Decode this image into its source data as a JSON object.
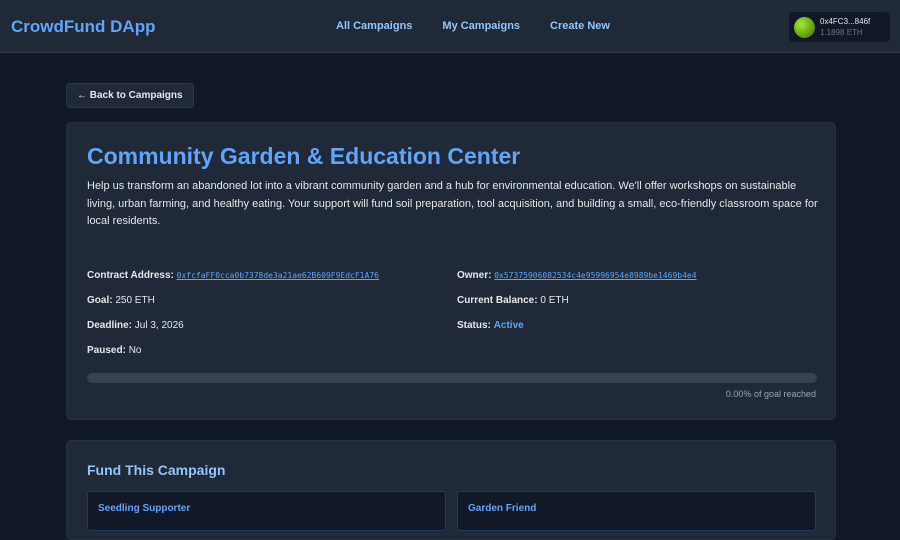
{
  "nav": {
    "brand": "CrowdFund DApp",
    "links": [
      "All Campaigns",
      "My Campaigns",
      "Create New"
    ],
    "wallet": {
      "address": "0x4FC3...846f",
      "balance": "1.1898 ETH"
    }
  },
  "back_label": "← Back to Campaigns",
  "campaign": {
    "title": "Community Garden & Education Center",
    "description": "Help us transform an abandoned lot into a vibrant community garden and a hub for environmental education. We'll offer workshops on sustainable living, urban farming, and healthy eating. Your support will fund soil preparation, tool acquisition, and building a small, eco-friendly classroom space for local residents.",
    "contract_label": "Contract Address:",
    "contract": "0xfcfaFF0cca0b7378de3a21ae62B609F9EdcF1A76",
    "owner_label": "Owner:",
    "owner": "0x57375906082534c4e95996954e8989be1469b4e4",
    "goal_label": "Goal:",
    "goal": "250 ETH",
    "balance_label": "Current Balance:",
    "balance": "0 ETH",
    "deadline_label": "Deadline:",
    "deadline": "Jul 3, 2026",
    "status_label": "Status:",
    "status": "Active",
    "paused_label": "Paused:",
    "paused": "No",
    "progress_fraction": 0.0,
    "progress_text": "0.00% of goal reached"
  },
  "fund": {
    "title": "Fund This Campaign",
    "tiers": [
      "Seedling Supporter",
      "Garden Friend"
    ]
  },
  "colors": {
    "background": "#111827",
    "surface": "#1f2937",
    "accent": "#60a5fa"
  }
}
